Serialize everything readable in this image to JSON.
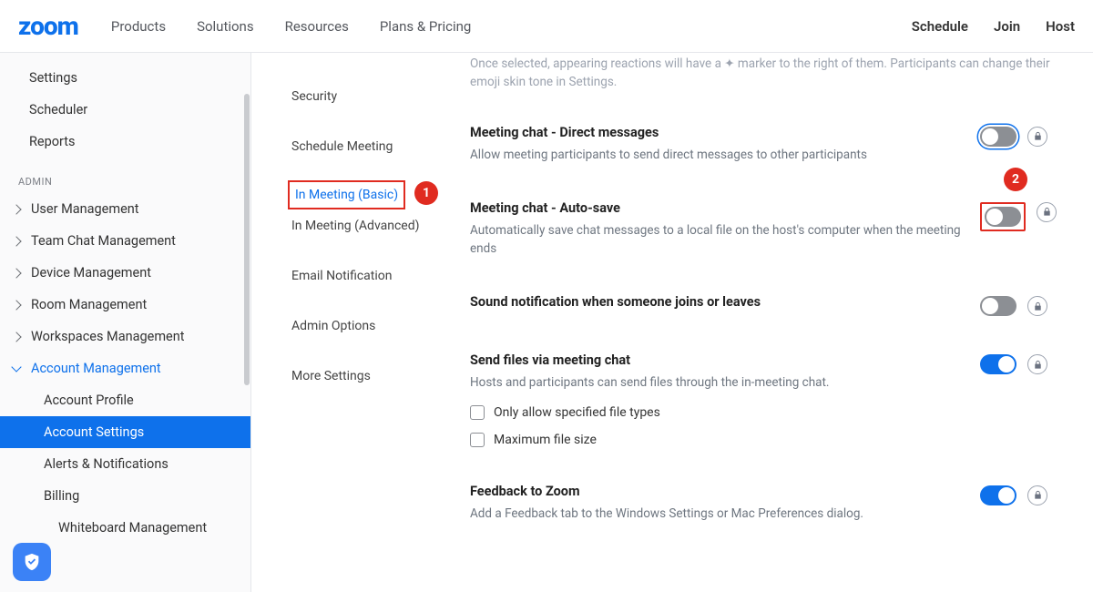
{
  "header": {
    "logo": "zoom",
    "nav": [
      "Products",
      "Solutions",
      "Resources",
      "Plans & Pricing"
    ],
    "actions": [
      "Schedule",
      "Join",
      "Host"
    ]
  },
  "sidebar": {
    "personal": [
      "Settings",
      "Scheduler",
      "Reports"
    ],
    "admin_label": "ADMIN",
    "admin": [
      {
        "label": "User Management"
      },
      {
        "label": "Team Chat Management"
      },
      {
        "label": "Device Management"
      },
      {
        "label": "Room Management"
      },
      {
        "label": "Workspaces Management"
      },
      {
        "label": "Account Management",
        "open": true,
        "children": [
          "Account Profile",
          "Account Settings",
          "Alerts & Notifications",
          "Billing",
          "Whiteboard Management"
        ]
      }
    ]
  },
  "tabs": [
    "Security",
    "Schedule Meeting",
    "In Meeting (Basic)",
    "In Meeting (Advanced)",
    "Email Notification",
    "Admin Options",
    "More Settings"
  ],
  "callouts": {
    "one": "1",
    "two": "2"
  },
  "faded_intro": "Once selected, appearing reactions will have a ✦ marker to the right of them. Participants can change their emoji skin tone in Settings.",
  "settings": [
    {
      "title": "Meeting chat - Direct messages",
      "desc": "Allow meeting participants to send direct messages to other participants",
      "on": false,
      "focused": true
    },
    {
      "title": "Meeting chat - Auto-save",
      "desc": "Automatically save chat messages to a local file on the host's computer when the meeting ends",
      "on": false,
      "marked": true
    },
    {
      "title": "Sound notification when someone joins or leaves",
      "desc": "",
      "on": false
    },
    {
      "title": "Send files via meeting chat",
      "desc": "Hosts and participants can send files through the in-meeting chat.",
      "on": true,
      "checks": [
        "Only allow specified file types",
        "Maximum file size"
      ]
    },
    {
      "title": "Feedback to Zoom",
      "desc": "Add a Feedback tab to the Windows Settings or Mac Preferences dialog.",
      "on": true
    }
  ]
}
